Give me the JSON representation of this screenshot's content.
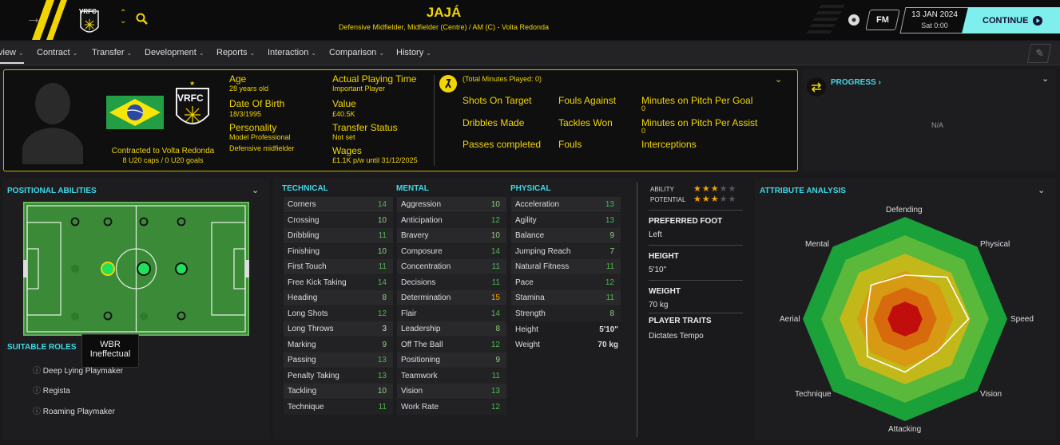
{
  "header": {
    "club_abbr": "VRFC",
    "player_name": "JAJÁ",
    "player_subtitle": "Defensive Midfielder, Midfielder (Centre) / AM (C) - Volta Redonda",
    "fm_badge": "FM",
    "date": "13 JAN 2024",
    "time": "Sat 0:00",
    "continue_label": "CONTINUE"
  },
  "nav": {
    "items": [
      "view",
      "Contract",
      "Transfer",
      "Development",
      "Reports",
      "Interaction",
      "Comparison",
      "History"
    ]
  },
  "profile": {
    "contract_text": "Contracted to Volta Redonda",
    "caps_text": "8 U20 caps / 0 U20 goals",
    "club_crest": "VRFC",
    "age_label": "Age",
    "age_value": "28 years old",
    "dob_label": "Date Of Birth",
    "dob_value": "18/3/1995",
    "personality_label": "Personality",
    "personality_value": "Model Professional",
    "personality_value2": "Defensive midfielder",
    "apt_label": "Actual Playing Time",
    "apt_value": "Important Player",
    "value_label": "Value",
    "value_value": "£40.5K",
    "transfer_label": "Transfer Status",
    "transfer_value": "Not set",
    "wages_label": "Wages",
    "wages_value": "£1.1K p/w until 31/12/2025"
  },
  "stats": {
    "minutes_text": "(Total Minutes Played: 0)",
    "col1": [
      "Shots On Target",
      "Dribbles Made",
      "Passes completed"
    ],
    "col2": [
      "Fouls Against",
      "Tackles Won",
      "Fouls"
    ],
    "col3": [
      "Minutes on Pitch Per Goal",
      "Minutes on Pitch Per Assist",
      "Interceptions"
    ],
    "col3_values": [
      "0",
      "0"
    ]
  },
  "progress": {
    "label": "PROGRESS",
    "value": "N/A"
  },
  "positional": {
    "title": "POSITIONAL ABILITIES",
    "tooltip_role": "WBR",
    "tooltip_rating": "Ineffectual",
    "suitable_title": "SUITABLE ROLES",
    "roles": [
      "Deep Lying Playmaker",
      "Regista",
      "Roaming Playmaker"
    ]
  },
  "technical": {
    "title": "TECHNICAL",
    "rows": [
      {
        "name": "Corners",
        "value": "14"
      },
      {
        "name": "Crossing",
        "value": "10"
      },
      {
        "name": "Dribbling",
        "value": "11"
      },
      {
        "name": "Finishing",
        "value": "10"
      },
      {
        "name": "First Touch",
        "value": "11"
      },
      {
        "name": "Free Kick Taking",
        "value": "14"
      },
      {
        "name": "Heading",
        "value": "8"
      },
      {
        "name": "Long Shots",
        "value": "12"
      },
      {
        "name": "Long Throws",
        "value": "3"
      },
      {
        "name": "Marking",
        "value": "9"
      },
      {
        "name": "Passing",
        "value": "13"
      },
      {
        "name": "Penalty Taking",
        "value": "13"
      },
      {
        "name": "Tackling",
        "value": "10"
      },
      {
        "name": "Technique",
        "value": "11"
      }
    ]
  },
  "mental": {
    "title": "MENTAL",
    "rows": [
      {
        "name": "Aggression",
        "value": "10"
      },
      {
        "name": "Anticipation",
        "value": "12"
      },
      {
        "name": "Bravery",
        "value": "10"
      },
      {
        "name": "Composure",
        "value": "14"
      },
      {
        "name": "Concentration",
        "value": "11"
      },
      {
        "name": "Decisions",
        "value": "11"
      },
      {
        "name": "Determination",
        "value": "15"
      },
      {
        "name": "Flair",
        "value": "14"
      },
      {
        "name": "Leadership",
        "value": "8"
      },
      {
        "name": "Off The Ball",
        "value": "12"
      },
      {
        "name": "Positioning",
        "value": "9"
      },
      {
        "name": "Teamwork",
        "value": "11"
      },
      {
        "name": "Vision",
        "value": "13"
      },
      {
        "name": "Work Rate",
        "value": "12"
      }
    ]
  },
  "physical": {
    "title": "PHYSICAL",
    "rows": [
      {
        "name": "Acceleration",
        "value": "13"
      },
      {
        "name": "Agility",
        "value": "13"
      },
      {
        "name": "Balance",
        "value": "9"
      },
      {
        "name": "Jumping Reach",
        "value": "7"
      },
      {
        "name": "Natural Fitness",
        "value": "11"
      },
      {
        "name": "Pace",
        "value": "12"
      },
      {
        "name": "Stamina",
        "value": "11"
      },
      {
        "name": "Strength",
        "value": "8"
      }
    ],
    "height_label": "Height",
    "height_value": "5'10\"",
    "weight_label": "Weight",
    "weight_value": "70 kg"
  },
  "info": {
    "ability_label": "ABILITY",
    "ability_stars": 3,
    "potential_label": "POTENTIAL",
    "potential_stars": 3,
    "foot_label": "PREFERRED FOOT",
    "foot_value": "Left",
    "height_label": "HEIGHT",
    "height_value": "5'10\"",
    "weight_label": "WEIGHT",
    "weight_value": "70 kg",
    "traits_label": "PLAYER TRAITS",
    "traits_value": "Dictates Tempo"
  },
  "analysis": {
    "title": "ATTRIBUTE ANALYSIS",
    "axes": [
      "Defending",
      "Physical",
      "Speed",
      "Vision",
      "Attacking",
      "Technique",
      "Aerial",
      "Mental"
    ],
    "values": [
      0.43,
      0.58,
      0.62,
      0.45,
      0.52,
      0.52,
      0.38,
      0.47
    ]
  },
  "colors": {
    "accent": "#f2d500",
    "cyan": "#3fd9e8",
    "green": "#4db84d",
    "orange": "#f5a300"
  }
}
